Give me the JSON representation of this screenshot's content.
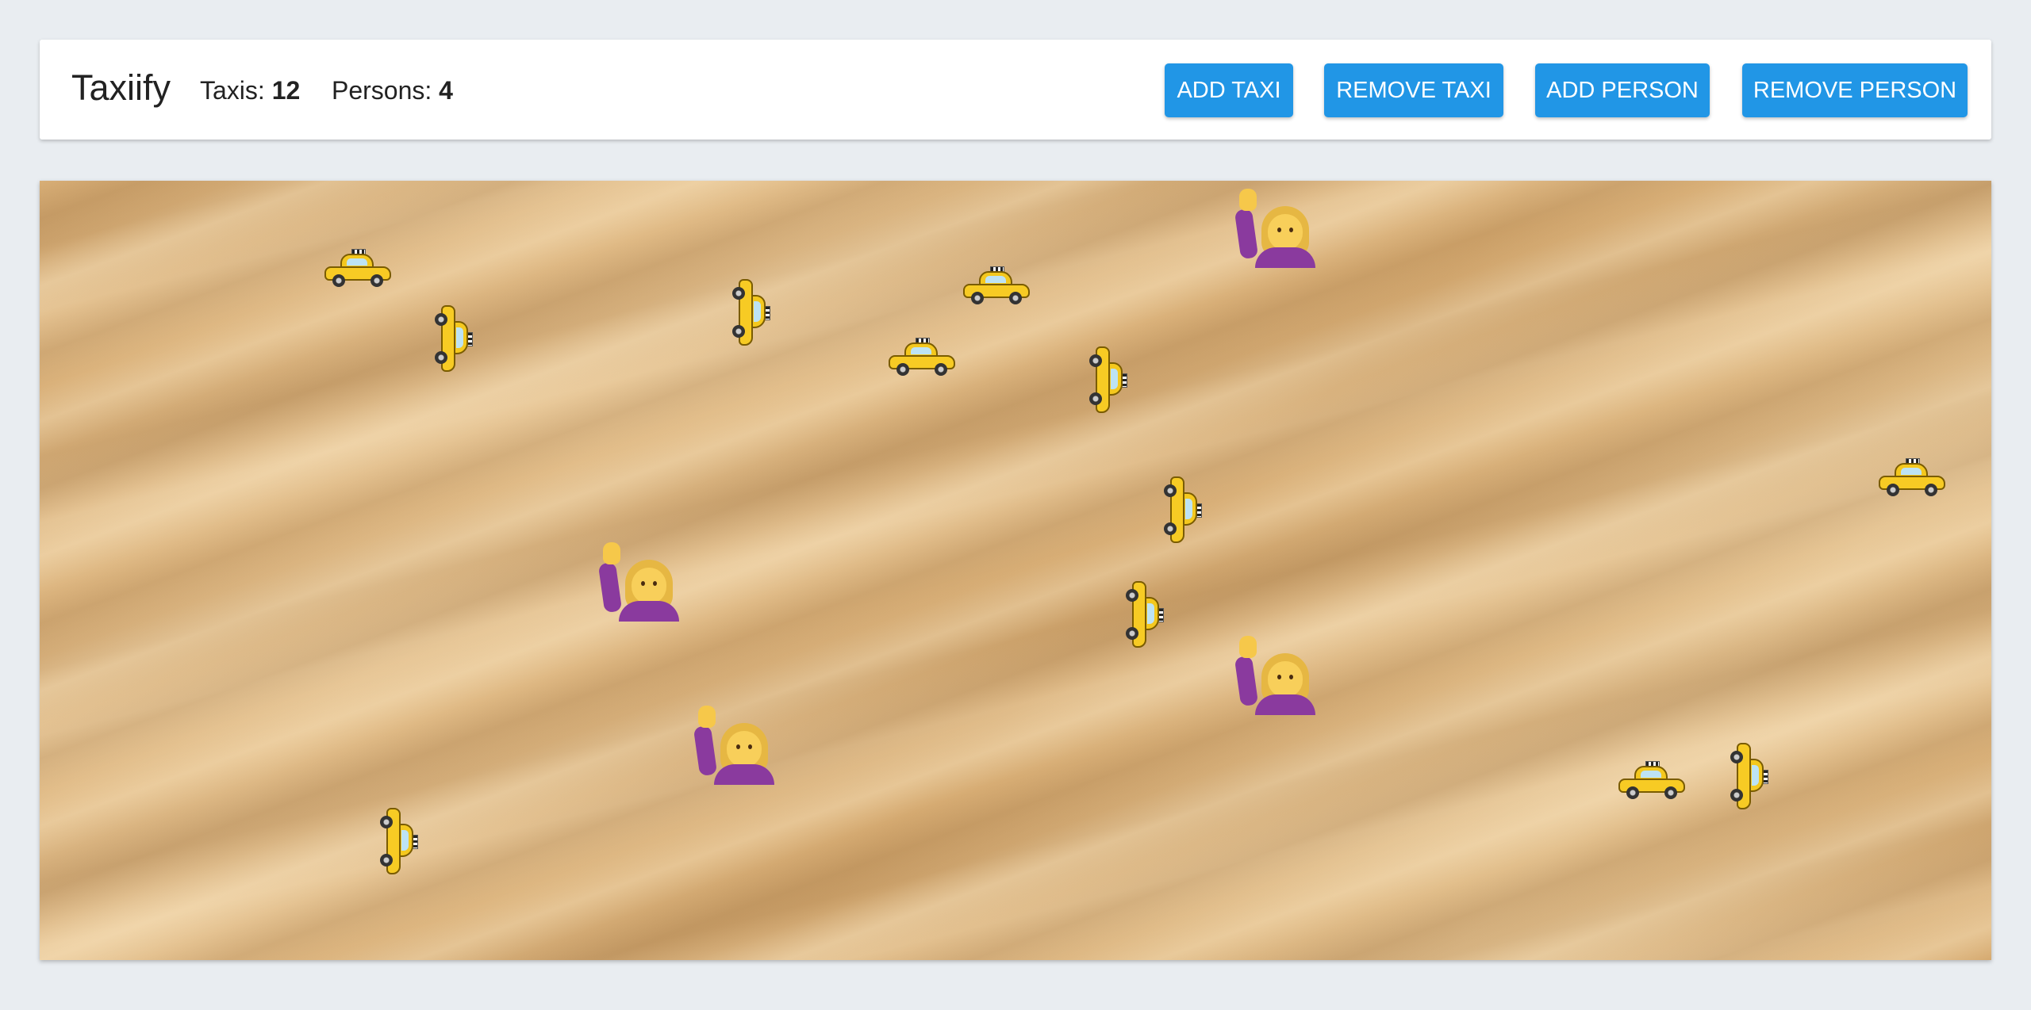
{
  "app": {
    "title": "Taxiify"
  },
  "counters": {
    "taxis_label": "Taxis:",
    "taxis_count": "12",
    "persons_label": "Persons:",
    "persons_count": "4"
  },
  "buttons": {
    "add_taxi": "ADD TAXI",
    "remove_taxi": "REMOVE TAXI",
    "add_person": "ADD PERSON",
    "remove_person": "REMOVE PERSON"
  },
  "colors": {
    "button": "#2196e6",
    "taxi": "#f7cb24",
    "person_shirt": "#8a3a9e"
  },
  "map": {
    "taxi_icon": "taxi-icon",
    "person_icon": "person-raising-hand-icon"
  }
}
